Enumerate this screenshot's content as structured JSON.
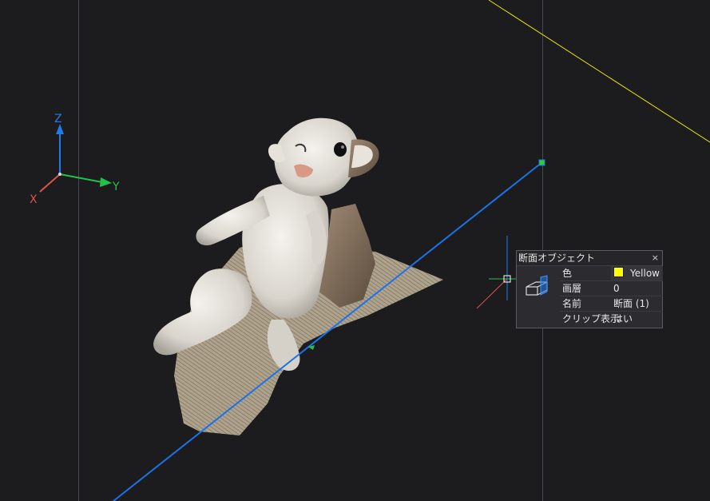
{
  "viewport": {
    "background": "#1c1c1e",
    "axis_labels": {
      "z": "Z",
      "y": "Y",
      "x": "X"
    },
    "axis_colors": {
      "x": "#d9534f",
      "y": "#22c24a",
      "z": "#1e7be8"
    },
    "section_line_color": "#1a73e8",
    "yellow_line_color": "#ffff00",
    "model": "bunny-scan"
  },
  "properties_panel": {
    "title": "断面オブジェクト",
    "close_glyph": "×",
    "icon": "section-plane-icon",
    "rows": [
      {
        "key": "色",
        "value": "Yellow",
        "swatch": "#ffff00"
      },
      {
        "key": "画層",
        "value": "0"
      },
      {
        "key": "名前",
        "value": "断面 (1)"
      },
      {
        "key": "クリップ表示",
        "value": "はい"
      }
    ]
  }
}
